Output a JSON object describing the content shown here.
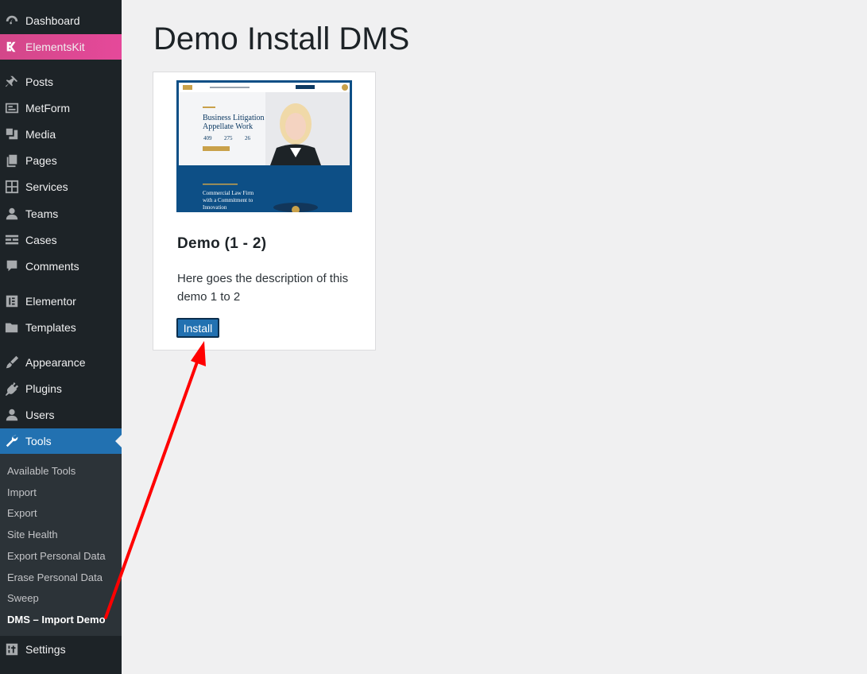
{
  "sidebar": {
    "items": [
      {
        "label": "Dashboard",
        "icon": "dashboard-icon"
      },
      {
        "label": "ElementsKit",
        "icon": "elementskit-icon"
      },
      {
        "label": "Posts",
        "icon": "pin-icon"
      },
      {
        "label": "MetForm",
        "icon": "form-icon"
      },
      {
        "label": "Media",
        "icon": "media-icon"
      },
      {
        "label": "Pages",
        "icon": "pages-icon"
      },
      {
        "label": "Services",
        "icon": "grid-icon"
      },
      {
        "label": "Teams",
        "icon": "user-icon"
      },
      {
        "label": "Cases",
        "icon": "list-icon"
      },
      {
        "label": "Comments",
        "icon": "comment-icon"
      },
      {
        "label": "Elementor",
        "icon": "elementor-icon"
      },
      {
        "label": "Templates",
        "icon": "folder-icon"
      },
      {
        "label": "Appearance",
        "icon": "brush-icon"
      },
      {
        "label": "Plugins",
        "icon": "plugin-icon"
      },
      {
        "label": "Users",
        "icon": "user-icon"
      },
      {
        "label": "Tools",
        "icon": "wrench-icon"
      },
      {
        "label": "Settings",
        "icon": "settings-icon"
      }
    ],
    "tools_submenu": [
      "Available Tools",
      "Import",
      "Export",
      "Site Health",
      "Export Personal Data",
      "Erase Personal Data",
      "Sweep",
      "DMS – Import Demo"
    ]
  },
  "main": {
    "title": "Demo Install DMS",
    "demo": {
      "title": "Demo (1 - 2)",
      "description": "Here goes the description of this demo 1 to 2",
      "install_label": "Install",
      "preview": {
        "headline_1": "Business Litigation",
        "amp": "&",
        "headline_2": "Appellate Work",
        "stats": [
          "409",
          "275",
          "26"
        ],
        "lower_heading_1": "Commercial Law Firm",
        "lower_heading_2": "with a Commitment to",
        "lower_heading_3": "Innovation"
      }
    }
  },
  "colors": {
    "sidebar_bg": "#1d2327",
    "accent": "#2271b1",
    "elementskit": "#e5499a",
    "arrow": "#ff0000"
  }
}
